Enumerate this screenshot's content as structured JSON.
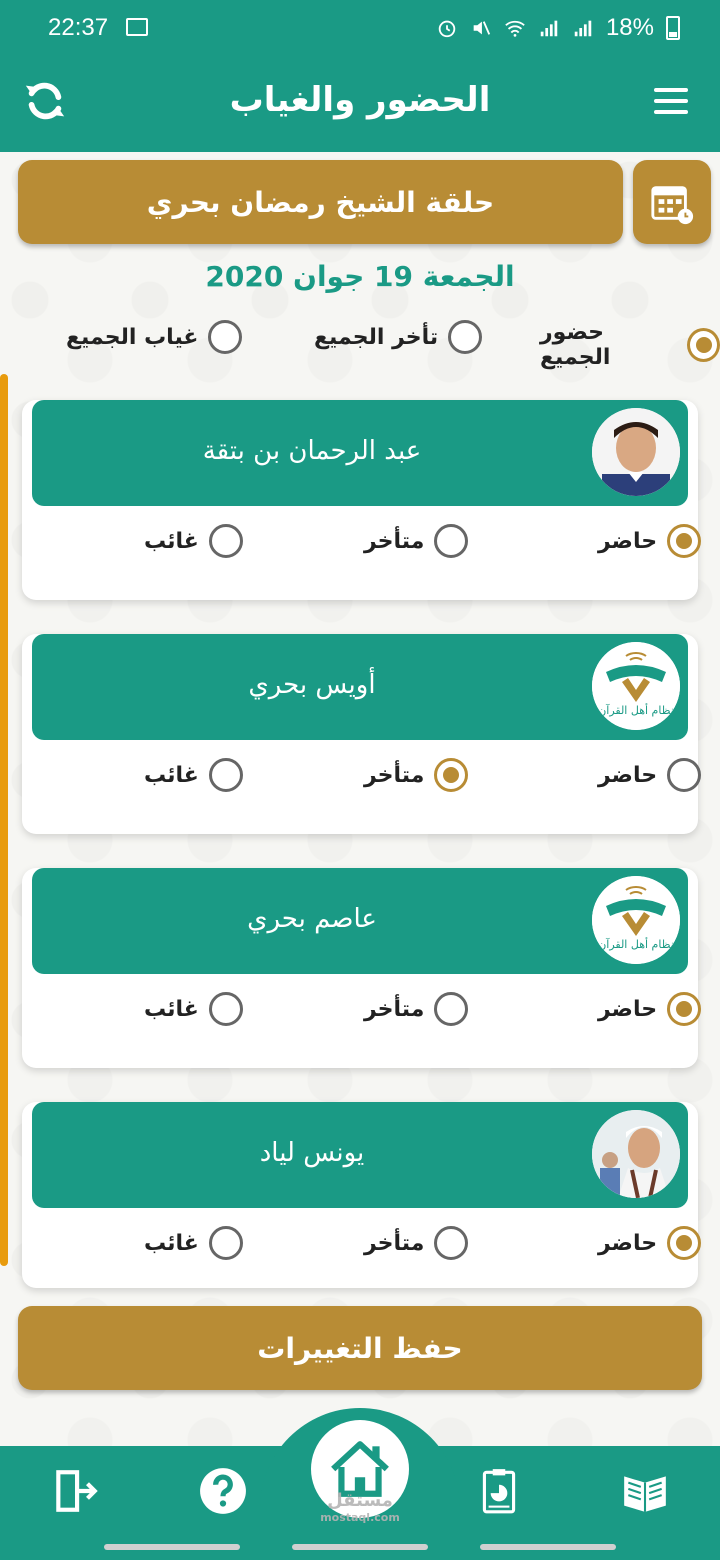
{
  "status": {
    "time": "22:37",
    "battery": "18%"
  },
  "appbar": {
    "title": "الحضور والغياب"
  },
  "halaqa": {
    "label": "حلقة الشيخ رمضان بحري"
  },
  "date": "الجمعة 19 جوان 2020",
  "bulk": {
    "present_all": "حضور الجميع",
    "late_all": "تأخر الجميع",
    "absent_all": "غياب الجميع",
    "selected": "present_all"
  },
  "options": {
    "present": "حاضر",
    "late": "متأخر",
    "absent": "غائب"
  },
  "students": [
    {
      "name": "عبد الرحمان بن بتقة",
      "status": "present",
      "avatar": "photo-boy"
    },
    {
      "name": "أويس بحري",
      "status": "late",
      "avatar": "logo-quran"
    },
    {
      "name": "عاصم بحري",
      "status": "present",
      "avatar": "logo-quran"
    },
    {
      "name": "يونس لياد",
      "status": "present",
      "avatar": "photo-man"
    }
  ],
  "logo_text": "نظام أهل القرآن",
  "save": {
    "label": "حفظ التغييرات"
  },
  "watermark": {
    "main": "مستقل",
    "sub": "mostaql.com"
  },
  "colors": {
    "primary": "#1a9a85",
    "accent": "#b88c35",
    "side_line": "#e89b0d"
  }
}
